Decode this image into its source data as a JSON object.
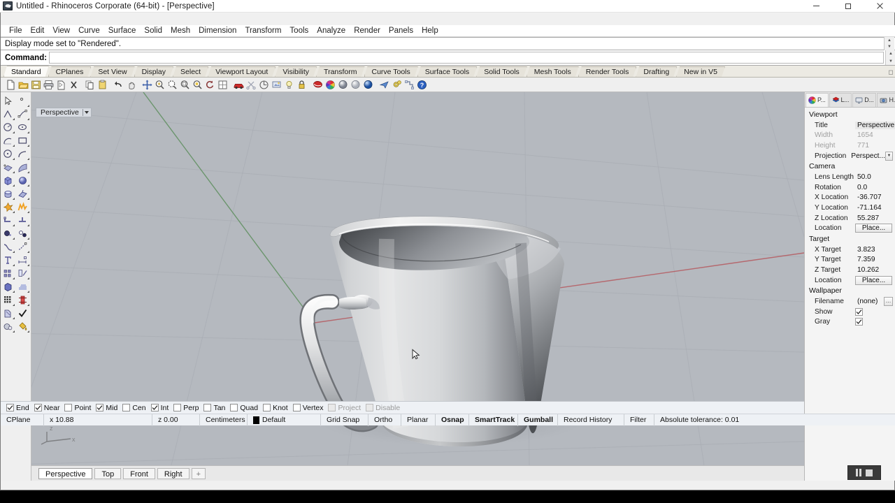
{
  "window": {
    "title": "Untitled - Rhinoceros Corporate (64-bit) - [Perspective]",
    "icon": "rhino-logo-icon",
    "controls": {
      "minimize": "minimize-icon",
      "maximize": "maximize-icon",
      "close": "close-icon"
    }
  },
  "menu": {
    "items": [
      "File",
      "Edit",
      "View",
      "Curve",
      "Surface",
      "Solid",
      "Mesh",
      "Dimension",
      "Transform",
      "Tools",
      "Analyze",
      "Render",
      "Panels",
      "Help"
    ]
  },
  "command": {
    "history_line": "Display mode set to \"Rendered\".",
    "prompt_label": "Command:",
    "input_value": "",
    "input_placeholder": ""
  },
  "toolbar_tabs": {
    "active": "Standard",
    "items": [
      "Standard",
      "CPlanes",
      "Set View",
      "Display",
      "Select",
      "Viewport Layout",
      "Visibility",
      "Transform",
      "Curve Tools",
      "Surface Tools",
      "Solid Tools",
      "Mesh Tools",
      "Render Tools",
      "Drafting",
      "New in V5"
    ]
  },
  "main_toolbar": {
    "buttons": [
      "new-file-icon",
      "open-folder-icon",
      "save-icon",
      "print-icon",
      "duplicate-icon",
      "delete-x-icon",
      "copy-icon",
      "paste-icon",
      "undo-icon",
      "redo-pan-icon",
      "move-crosshair-icon",
      "zoom-in-icon",
      "zoom-window-icon",
      "zoom-extents-icon",
      "zoom-selected-icon",
      "rotate-view-icon",
      "grid-snap-icon",
      "render-car-icon",
      "scissors-icon",
      "revolve-icon",
      "render-preview-icon",
      "light-bulb-icon",
      "lock-icon",
      "material-icon",
      "color-wheel-icon",
      "shaded-sphere-icon",
      "ghosted-sphere-icon",
      "rendered-sphere-icon",
      "paper-plane-icon",
      "gears-options-icon",
      "layout-icon",
      "help-question-icon"
    ]
  },
  "left_toolbar": {
    "buttons": [
      "select-arrow-icon",
      "select-point-icon",
      "polyline-icon",
      "control-point-curve-icon",
      "circle-icon",
      "ellipse-icon",
      "arc-icon",
      "rectangle-icon",
      "circle-center-icon",
      "curve-blend-icon",
      "surface-edit-icon",
      "surface-from-curves-icon",
      "box-icon",
      "sphere-icon",
      "cylinder-icon",
      "extrude-surface-icon",
      "explode-icon",
      "boolean-icon",
      "join-icon",
      "trim-icon",
      "offset-icon",
      "fillet-icon",
      "curve-tools-icon",
      "curve-from-object-icon",
      "text-icon",
      "dimension-icon",
      "array-icon",
      "copy-object-icon",
      "solid-tools-icon",
      "mesh-icon",
      "layout-grid-icon",
      "analyze-icon",
      "transform-icon",
      "checkmark-icon",
      "render-tools-icon",
      "paint-bucket-icon"
    ]
  },
  "viewport": {
    "label": "Perspective",
    "background_color": "#b5b9bf",
    "axes": {
      "x_color": "#c0524f",
      "y_color": "#4f8a4f",
      "z_label": "z",
      "x_label": "x"
    },
    "object": "pitcher-jug-3d-model",
    "cursor": "arrow-cursor",
    "tabs": {
      "active": "Perspective",
      "items": [
        "Perspective",
        "Top",
        "Front",
        "Right"
      ],
      "add": "+"
    }
  },
  "properties_panel": {
    "tabs": [
      {
        "label": "P...",
        "icon": "properties-color-wheel-icon",
        "active": true
      },
      {
        "label": "L...",
        "icon": "layers-icon",
        "active": false
      },
      {
        "label": "D...",
        "icon": "display-monitor-icon",
        "active": false
      },
      {
        "label": "H...",
        "icon": "help-camera-icon",
        "active": false
      }
    ],
    "options_icon": "gear-icon",
    "groups": [
      {
        "name": "Viewport",
        "rows": [
          {
            "label": "Title",
            "value": "Perspective",
            "type": "text",
            "selected": true
          },
          {
            "label": "Width",
            "value": "1654",
            "type": "readonly"
          },
          {
            "label": "Height",
            "value": "771",
            "type": "readonly"
          },
          {
            "label": "Projection",
            "value": "Perspect...",
            "type": "combo"
          }
        ]
      },
      {
        "name": "Camera",
        "rows": [
          {
            "label": "Lens Length",
            "value": "50.0",
            "type": "text"
          },
          {
            "label": "Rotation",
            "value": "0.0",
            "type": "text"
          },
          {
            "label": "X Location",
            "value": "-36.707",
            "type": "text"
          },
          {
            "label": "Y Location",
            "value": "-71.164",
            "type": "text"
          },
          {
            "label": "Z Location",
            "value": "55.287",
            "type": "text"
          },
          {
            "label": "Location",
            "value": "Place...",
            "type": "button"
          }
        ]
      },
      {
        "name": "Target",
        "rows": [
          {
            "label": "X Target",
            "value": "3.823",
            "type": "text"
          },
          {
            "label": "Y Target",
            "value": "7.359",
            "type": "text"
          },
          {
            "label": "Z Target",
            "value": "10.262",
            "type": "text"
          },
          {
            "label": "Location",
            "value": "Place...",
            "type": "button"
          }
        ]
      },
      {
        "name": "Wallpaper",
        "rows": [
          {
            "label": "Filename",
            "value": "(none)",
            "type": "file"
          },
          {
            "label": "Show",
            "value": "checked",
            "type": "checkbox"
          },
          {
            "label": "Gray",
            "value": "checked",
            "type": "checkbox"
          }
        ]
      }
    ]
  },
  "osnap_bar": {
    "items": [
      {
        "label": "End",
        "checked": true,
        "enabled": true
      },
      {
        "label": "Near",
        "checked": true,
        "enabled": true
      },
      {
        "label": "Point",
        "checked": false,
        "enabled": true
      },
      {
        "label": "Mid",
        "checked": true,
        "enabled": true
      },
      {
        "label": "Cen",
        "checked": false,
        "enabled": true
      },
      {
        "label": "Int",
        "checked": true,
        "enabled": true
      },
      {
        "label": "Perp",
        "checked": false,
        "enabled": true
      },
      {
        "label": "Tan",
        "checked": false,
        "enabled": true
      },
      {
        "label": "Quad",
        "checked": false,
        "enabled": true
      },
      {
        "label": "Knot",
        "checked": false,
        "enabled": true
      },
      {
        "label": "Vertex",
        "checked": false,
        "enabled": true
      },
      {
        "label": "Project",
        "checked": false,
        "enabled": false
      },
      {
        "label": "Disable",
        "checked": false,
        "enabled": false
      }
    ]
  },
  "status_bar": {
    "cplane_label": "CPlane",
    "x_value": "x 10.88",
    "z_value": "z 0.00",
    "units": "Centimeters",
    "layer_swatch_color": "#000000",
    "layer_name": "Default",
    "toggles": [
      {
        "label": "Grid Snap",
        "active": false
      },
      {
        "label": "Ortho",
        "active": false
      },
      {
        "label": "Planar",
        "active": false
      },
      {
        "label": "Osnap",
        "active": true
      },
      {
        "label": "SmartTrack",
        "active": true
      },
      {
        "label": "Gumball",
        "active": true
      },
      {
        "label": "Record History",
        "active": false
      },
      {
        "label": "Filter",
        "active": false
      }
    ],
    "tolerance": "Absolute tolerance: 0.01"
  },
  "media_controls": {
    "pause": "pause-icon",
    "stop": "stop-icon"
  }
}
